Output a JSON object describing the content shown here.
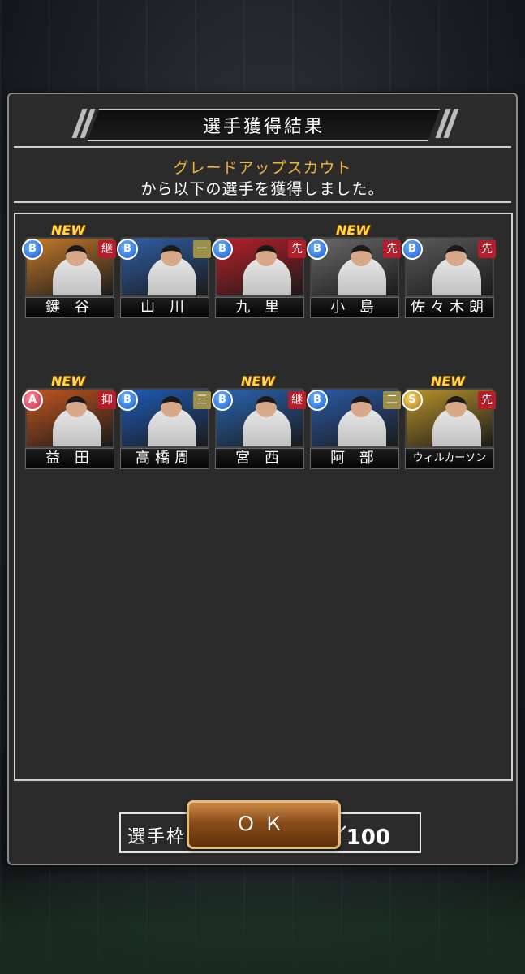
{
  "dialog": {
    "title": "選手獲得結果",
    "subtitle_scout": "グレードアップスカウト",
    "subtitle_text": "から以下の選手を獲得しました。"
  },
  "players": [
    {
      "name": "鍵 谷",
      "grade": "B",
      "position": "継",
      "new": true,
      "art_color": "#c47a2a"
    },
    {
      "name": "山 川",
      "grade": "B",
      "position": "一",
      "new": false,
      "art_color": "#2f5fa8"
    },
    {
      "name": "九 里",
      "grade": "B",
      "position": "先",
      "new": false,
      "art_color": "#b8202a"
    },
    {
      "name": "小 島",
      "grade": "B",
      "position": "先",
      "new": true,
      "art_color": "#6a6a6a"
    },
    {
      "name": "佐々木朗",
      "grade": "B",
      "position": "先",
      "new": false,
      "art_color": "#5a5a5a"
    },
    {
      "name": "益 田",
      "grade": "A",
      "position": "抑",
      "new": true,
      "art_color": "#c2561f"
    },
    {
      "name": "高橋周",
      "grade": "B",
      "position": "三",
      "new": false,
      "art_color": "#1f5bb8"
    },
    {
      "name": "宮 西",
      "grade": "B",
      "position": "継",
      "new": true,
      "art_color": "#2a64b2"
    },
    {
      "name": "阿 部",
      "grade": "B",
      "position": "二",
      "new": false,
      "art_color": "#2a5aa8"
    },
    {
      "name": "ウィルカーソン",
      "grade": "S",
      "position": "先",
      "new": true,
      "art_color": "#b8932a"
    }
  ],
  "labels": {
    "new_badge": "NEW"
  },
  "roster": {
    "label": "選手枠：",
    "value": "44／100"
  },
  "ok_button": {
    "label": "ＯＫ"
  }
}
